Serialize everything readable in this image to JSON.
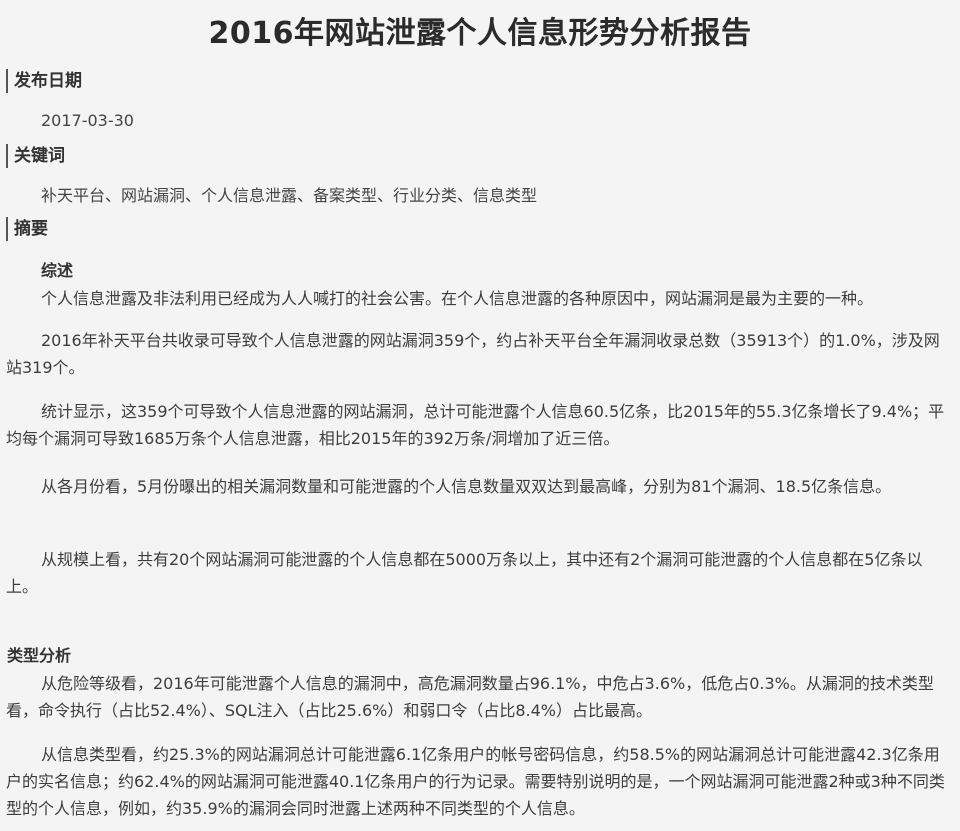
{
  "title": "2016年网站泄露个人信息形势分析报告",
  "release_date": {
    "label": "发布日期",
    "value": "2017-03-30"
  },
  "keywords": {
    "label": "关键词",
    "value": "补天平台、网站漏洞、个人信息泄露、备案类型、行业分类、信息类型"
  },
  "abstract": {
    "label": "摘要",
    "overview_label": "综述",
    "paragraphs": [
      "个人信息泄露及非法利用已经成为人人喊打的社会公害。在个人信息泄露的各种原因中，网站漏洞是最为主要的一种。",
      "2016年补天平台共收录可导致个人信息泄露的网站漏洞359个，约占补天平台全年漏洞收录总数（35913个）的1.0%，涉及网站319个。",
      "统计显示，这359个可导致个人信息泄露的网站漏洞，总计可能泄露个人信息60.5亿条，比2015年的55.3亿条增长了9.4%；平均每个漏洞可导致1685万条个人信息泄露，相比2015年的392万条/洞增加了近三倍。",
      "从各月份看，5月份曝出的相关漏洞数量和可能泄露的个人信息数量双双达到最高峰，分别为81个漏洞、18.5亿条信息。",
      "从规模上看，共有20个网站漏洞可能泄露的个人信息都在5000万条以上，其中还有2个漏洞可能泄露的个人信息都在5亿条以上。"
    ]
  },
  "type_analysis": {
    "label": "类型分析",
    "paragraphs": [
      "从危险等级看，2016年可能泄露个人信息的漏洞中，高危漏洞数量占96.1%，中危占3.6%，低危占0.3%。从漏洞的技术类型看，命令执行（占比52.4%）、SQL注入（占比25.6%）和弱口令（占比8.4%）占比最高。",
      "从信息类型看，约25.3%的网站漏洞总计可能泄露6.1亿条用户的帐号密码信息，约58.5%的网站漏洞总计可能泄露42.3亿条用户的实名信息；约62.4%的网站漏洞可能泄露40.1亿条用户的行为记录。需要特别说明的是，一个网站漏洞可能泄露2种或3种不同类型的个人信息，例如，约35.9%的漏洞会同时泄露上述两种不同类型的个人信息。"
    ]
  }
}
